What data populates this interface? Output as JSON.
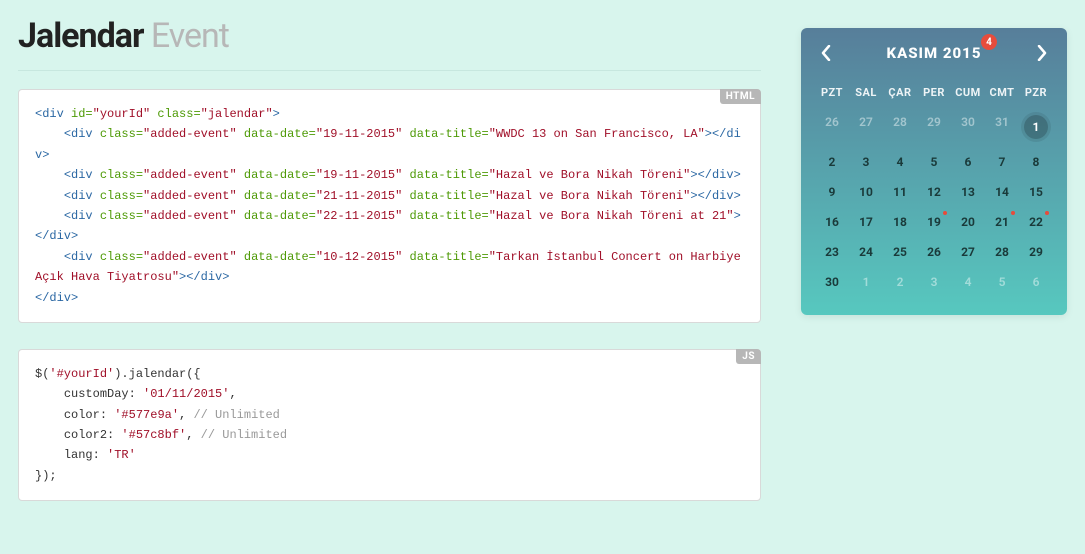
{
  "title": {
    "strong": "Jalendar",
    "light": "Event"
  },
  "code_html": {
    "tag": "HTML",
    "lines": [
      [
        [
          "tag",
          "<div"
        ],
        [
          "attr",
          " id="
        ],
        [
          "str",
          "\"yourId\""
        ],
        [
          "attr",
          " class="
        ],
        [
          "str",
          "\"jalendar\""
        ],
        [
          "tag",
          ">"
        ]
      ],
      [
        [
          "txt",
          "    "
        ],
        [
          "tag",
          "<div"
        ],
        [
          "attr",
          " class="
        ],
        [
          "str",
          "\"added-event\""
        ],
        [
          "attr",
          " data-date="
        ],
        [
          "str",
          "\"19-11-2015\""
        ],
        [
          "attr",
          " data-title="
        ],
        [
          "str",
          "\"WWDC 13 on San Francisco, LA\""
        ],
        [
          "tag",
          "></"
        ],
        [
          "tag",
          "div>"
        ]
      ],
      [
        [
          "txt",
          "    "
        ],
        [
          "tag",
          "<div"
        ],
        [
          "attr",
          " class="
        ],
        [
          "str",
          "\"added-event\""
        ],
        [
          "attr",
          " data-date="
        ],
        [
          "str",
          "\"19-11-2015\""
        ],
        [
          "attr",
          " data-title="
        ],
        [
          "str",
          "\"Hazal ve Bora Nikah Töreni\""
        ],
        [
          "tag",
          "></di"
        ],
        [
          "tag",
          "v>"
        ]
      ],
      [
        [
          "txt",
          "    "
        ],
        [
          "tag",
          "<div"
        ],
        [
          "attr",
          " class="
        ],
        [
          "str",
          "\"added-event\""
        ],
        [
          "attr",
          " data-date="
        ],
        [
          "str",
          "\"21-11-2015\""
        ],
        [
          "attr",
          " data-title="
        ],
        [
          "str",
          "\"Hazal ve Bora Nikah Töreni\""
        ],
        [
          "tag",
          "></di"
        ],
        [
          "tag",
          "v>"
        ]
      ],
      [
        [
          "txt",
          "    "
        ],
        [
          "tag",
          "<div"
        ],
        [
          "attr",
          " class="
        ],
        [
          "str",
          "\"added-event\""
        ],
        [
          "attr",
          " data-date="
        ],
        [
          "str",
          "\"22-11-2015\""
        ],
        [
          "attr",
          " data-title="
        ],
        [
          "str",
          "\"Hazal ve Bora Nikah Töreni at 21\""
        ],
        [
          "tag",
          "></div>"
        ]
      ],
      [
        [
          "txt",
          "    "
        ],
        [
          "tag",
          "<div"
        ],
        [
          "attr",
          " class="
        ],
        [
          "str",
          "\"added-event\""
        ],
        [
          "attr",
          " data-date="
        ],
        [
          "str",
          "\"10-12-2015\""
        ],
        [
          "attr",
          " data-title="
        ],
        [
          "str",
          "\"Tarkan İstanbul Concert on Harbiye Açık Hava Tiyatrosu\""
        ],
        [
          "tag",
          "></div>"
        ]
      ],
      [
        [
          "tag",
          "</div>"
        ]
      ]
    ]
  },
  "code_js": {
    "tag": "JS",
    "lines": [
      [
        [
          "txt",
          "$("
        ],
        [
          "str",
          "'#yourId'"
        ],
        [
          "txt",
          ").jalendar({"
        ]
      ],
      [
        [
          "txt",
          "    customDay: "
        ],
        [
          "str",
          "'01/11/2015'"
        ],
        [
          "txt",
          ","
        ]
      ],
      [
        [
          "txt",
          "    color: "
        ],
        [
          "str",
          "'#577e9a'"
        ],
        [
          "txt",
          ", "
        ],
        [
          "cm",
          "// Unlimited"
        ]
      ],
      [
        [
          "txt",
          "    color2: "
        ],
        [
          "str",
          "'#57c8bf'"
        ],
        [
          "txt",
          ", "
        ],
        [
          "cm",
          "// Unlimited"
        ]
      ],
      [
        [
          "txt",
          "    lang: "
        ],
        [
          "str",
          "'TR'"
        ]
      ],
      [
        [
          "txt",
          "});"
        ]
      ]
    ]
  },
  "calendar": {
    "title": "KASIM 2015",
    "badge": "4",
    "weekdays": [
      "PZT",
      "SAL",
      "ÇAR",
      "PER",
      "CUM",
      "CMT",
      "PZR"
    ],
    "weeks": [
      [
        {
          "n": "26",
          "dim": true
        },
        {
          "n": "27",
          "dim": true
        },
        {
          "n": "28",
          "dim": true
        },
        {
          "n": "29",
          "dim": true
        },
        {
          "n": "30",
          "dim": true
        },
        {
          "n": "31",
          "dim": true
        },
        {
          "n": "1",
          "sel": true
        }
      ],
      [
        {
          "n": "2"
        },
        {
          "n": "3"
        },
        {
          "n": "4"
        },
        {
          "n": "5"
        },
        {
          "n": "6"
        },
        {
          "n": "7"
        },
        {
          "n": "8"
        }
      ],
      [
        {
          "n": "9"
        },
        {
          "n": "10"
        },
        {
          "n": "11"
        },
        {
          "n": "12"
        },
        {
          "n": "13"
        },
        {
          "n": "14"
        },
        {
          "n": "15"
        }
      ],
      [
        {
          "n": "16"
        },
        {
          "n": "17"
        },
        {
          "n": "18"
        },
        {
          "n": "19",
          "dot": true
        },
        {
          "n": "20"
        },
        {
          "n": "21",
          "dot": true
        },
        {
          "n": "22",
          "dot": true
        }
      ],
      [
        {
          "n": "23"
        },
        {
          "n": "24"
        },
        {
          "n": "25"
        },
        {
          "n": "26"
        },
        {
          "n": "27"
        },
        {
          "n": "28"
        },
        {
          "n": "29"
        }
      ],
      [
        {
          "n": "30"
        },
        {
          "n": "1",
          "dim": true
        },
        {
          "n": "2",
          "dim": true
        },
        {
          "n": "3",
          "dim": true
        },
        {
          "n": "4",
          "dim": true
        },
        {
          "n": "5",
          "dim": true
        },
        {
          "n": "6",
          "dim": true
        }
      ]
    ]
  }
}
